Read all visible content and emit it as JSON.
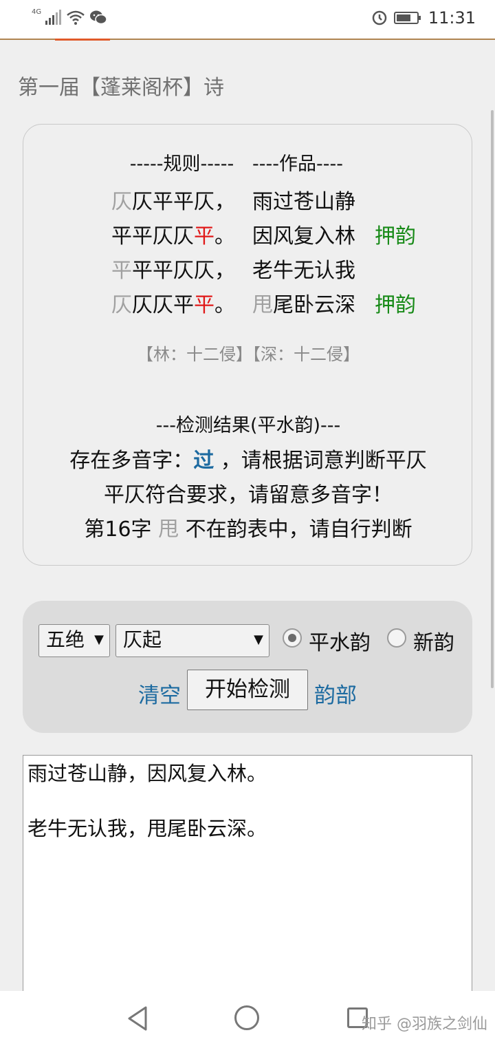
{
  "status_bar": {
    "network_tag": "4G",
    "time": "11:31"
  },
  "page": {
    "title": "第一届【蓬莱阁杯】诗"
  },
  "rules": {
    "header_rules": "-----规则-----",
    "header_work": "----作品----",
    "rows": [
      {
        "pattern": [
          {
            "t": "仄",
            "c": "gray"
          },
          {
            "t": "仄平平仄，",
            "c": ""
          }
        ],
        "verse": [
          {
            "t": "雨过苍山静",
            "c": ""
          }
        ],
        "rhyme": ""
      },
      {
        "pattern": [
          {
            "t": "平平仄仄",
            "c": ""
          },
          {
            "t": "平",
            "c": "red"
          },
          {
            "t": "。",
            "c": ""
          }
        ],
        "verse": [
          {
            "t": "因风复入林",
            "c": ""
          }
        ],
        "rhyme": "押韵"
      },
      {
        "pattern": [
          {
            "t": "平",
            "c": "gray"
          },
          {
            "t": "平平仄仄，",
            "c": ""
          }
        ],
        "verse": [
          {
            "t": "老牛无认我",
            "c": ""
          }
        ],
        "rhyme": ""
      },
      {
        "pattern": [
          {
            "t": "仄",
            "c": "gray"
          },
          {
            "t": "仄仄平",
            "c": ""
          },
          {
            "t": "平",
            "c": "red"
          },
          {
            "t": "。",
            "c": ""
          }
        ],
        "verse": [
          {
            "t": "甩",
            "c": "gray"
          },
          {
            "t": "尾卧云深",
            "c": ""
          }
        ],
        "rhyme": "押韵"
      }
    ],
    "rhyme_info": "【林：十二侵】【深：十二侵】"
  },
  "check": {
    "title": "---检测结果(平水韵)---",
    "line1_prefix": "存在多音字：",
    "line1_char": "过",
    "line1_suffix": " ，请根据词意判断平仄",
    "line2": "平仄符合要求，请留意多音字！",
    "line3_prefix": "第16字 ",
    "line3_char": "甩",
    "line3_suffix": " 不在韵表中，请自行判断"
  },
  "controls": {
    "form_select": "五绝",
    "start_select": "仄起",
    "radio_pingshui": "平水韵",
    "radio_xinyun": "新韵",
    "selected_rhyme": "平水韵",
    "clear_link": "清空",
    "start_button": "开始检测",
    "rhyme_link": "韵部"
  },
  "editor": {
    "lines": [
      "雨过苍山静，因风复入林。",
      "老牛无认我，甩尾卧云深。"
    ]
  },
  "nav": {
    "watermark": "知乎 @羽族之剑仙"
  },
  "colors": {
    "accent_link": "#1c6aa0",
    "rhyme_green": "#178a17",
    "level_red": "#e01818"
  },
  "icons": [
    "signal-icon",
    "wifi-icon",
    "wechat-icon",
    "alarm-icon",
    "battery-icon",
    "back-icon",
    "home-icon",
    "recent-apps-icon"
  ]
}
